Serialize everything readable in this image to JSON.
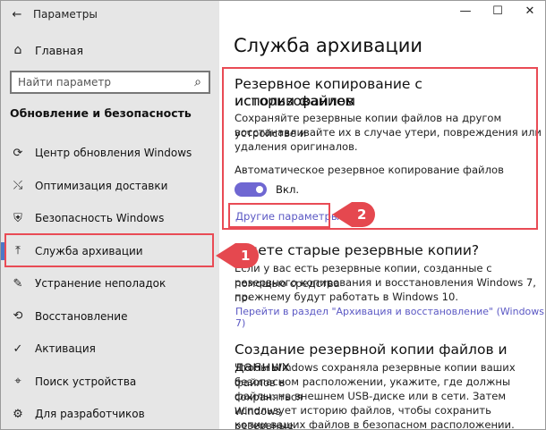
{
  "window": {
    "title": "Параметры",
    "back_glyph": "←",
    "minimize_glyph": "—",
    "maximize_glyph": "☐",
    "close_glyph": "✕"
  },
  "sidebar": {
    "home_label": "Главная",
    "search_placeholder": "Найти параметр",
    "section_title": "Обновление и безопасность",
    "items": [
      {
        "label": "Центр обновления Windows",
        "icon": "refresh-icon",
        "glyph": "⟳"
      },
      {
        "label": "Оптимизация доставки",
        "icon": "delivery-icon",
        "glyph": "⤯"
      },
      {
        "label": "Безопасность Windows",
        "icon": "shield-icon",
        "glyph": "⛨"
      },
      {
        "label": "Служба архивации",
        "icon": "backup-icon",
        "glyph": "⤒"
      },
      {
        "label": "Устранение неполадок",
        "icon": "wrench-icon",
        "glyph": "🔧"
      },
      {
        "label": "Восстановление",
        "icon": "recovery-icon",
        "glyph": "⟲"
      },
      {
        "label": "Активация",
        "icon": "activation-icon",
        "glyph": "✓"
      },
      {
        "label": "Поиск устройства",
        "icon": "find-device-icon",
        "glyph": "⌖"
      },
      {
        "label": "Для разработчиков",
        "icon": "developer-icon",
        "glyph": "⚙"
      }
    ]
  },
  "main": {
    "page_title": "Служба архивации",
    "section1": {
      "heading_line1": "Резервное копирование с использованием",
      "heading_line2": "истории файлов",
      "desc_line1": "Сохраняйте резервные копии файлов на другом устройстве и",
      "desc_line2": "восстанавливайте их в случае утери, повреждения или",
      "desc_line3": "удаления оригиналов.",
      "auto_label": "Автоматическое резервное копирование файлов",
      "toggle_state": "Вкл.",
      "more_options_link": "Другие параметры"
    },
    "section2": {
      "heading": "Ищете старые резервные копии?",
      "desc_line1": "Если у вас есть резервные копии, созданные с помощью средства",
      "desc_line2": "резервного копирования и восстановления Windows 7, по-",
      "desc_line3": "прежнему будут работать в Windows 10.",
      "link": "Перейти в раздел \"Архивация и восстановление\" (Windows 7)"
    },
    "section3": {
      "heading": "Создание резервной копии файлов и данных",
      "desc_line1": "Чтобы Windows сохраняла резервные копии ваших файлов в",
      "desc_line2": "безопасном расположении, укажите, где должны сохраняться",
      "desc_line3": "файлы: на внешнем USB-диске или в сети. Затем Windows",
      "desc_line4": "использует историю файлов, чтобы сохранить резервные",
      "desc_line5": "копии ваших файлов в безопасном расположении."
    }
  },
  "annotations": {
    "badge1": "1",
    "badge2": "2",
    "color": "#e5484f"
  },
  "colors": {
    "accent": "#6f67d2",
    "link": "#5b58c4",
    "sidebar_bg": "#e6e6e6",
    "highlight": "#e94b55"
  }
}
